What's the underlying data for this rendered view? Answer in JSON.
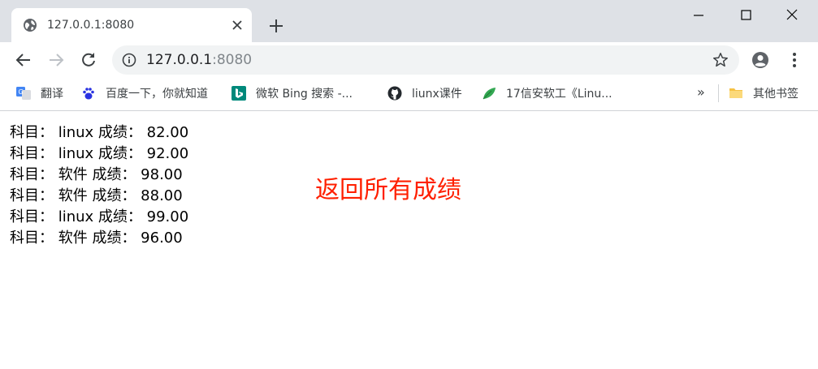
{
  "window": {
    "tab_title": "127.0.0.1:8080",
    "controls": [
      "minimize-icon",
      "maximize-icon",
      "close-icon"
    ]
  },
  "toolbar": {
    "url_host": "127.0.0.1",
    "url_port": ":8080"
  },
  "bookmarks": {
    "items": [
      {
        "label": "翻译",
        "icon": "google-translate-icon"
      },
      {
        "label": "百度一下，你就知道",
        "icon": "baidu-paw-icon"
      },
      {
        "label": "微软 Bing 搜索 -...",
        "icon": "bing-icon"
      },
      {
        "label": "liunx课件",
        "icon": "github-icon"
      },
      {
        "label": "17信安软工《Linu...",
        "icon": "leaf-icon"
      }
    ],
    "overflow": "»",
    "other_folder": "其他书签"
  },
  "page": {
    "rows": [
      "科目：  linux 成绩：  82.00",
      "科目：  linux 成绩：  92.00",
      "科目：  软件 成绩：  98.00",
      "科目：  软件 成绩：  88.00",
      "科目：  linux 成绩：  99.00",
      "科目：  软件 成绩：  96.00"
    ],
    "annotation": "返回所有成绩"
  },
  "colors": {
    "annotation": "#ff2000",
    "titlebar": "#dee1e6",
    "omnibox": "#f1f3f4"
  }
}
